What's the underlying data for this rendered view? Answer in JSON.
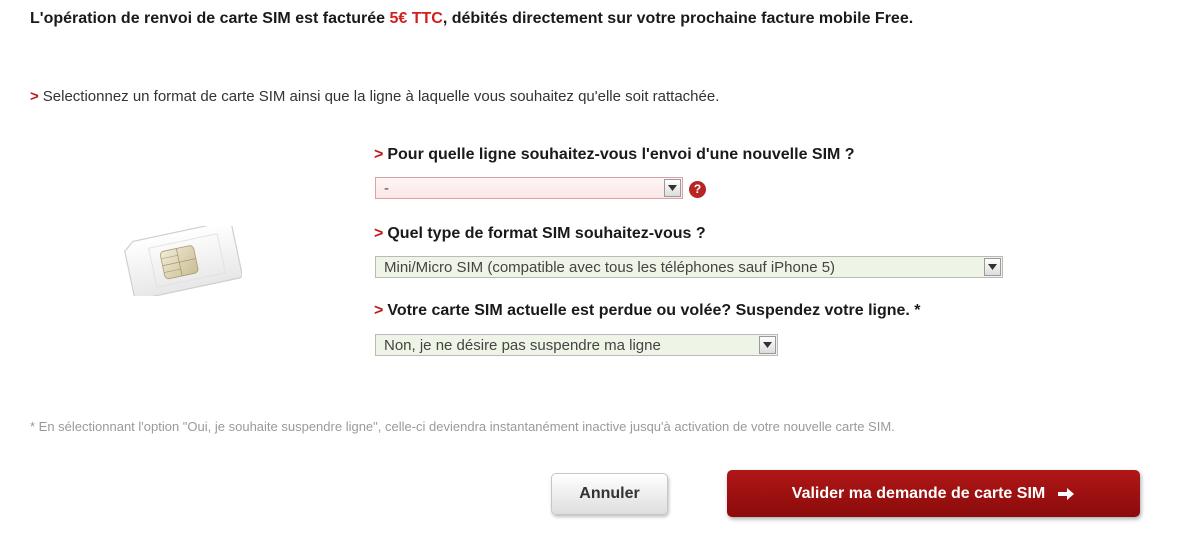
{
  "notice": {
    "prefix": "L'opération de renvoi de carte SIM est facturée ",
    "price": "5€ TTC",
    "suffix": ", débités directement sur votre prochaine facture mobile Free."
  },
  "instruction": {
    "marker": ">",
    "text": "Selectionnez un format de carte SIM ainsi que la ligne à laquelle vous souhaitez qu'elle soit rattachée."
  },
  "questions": [
    {
      "marker": ">",
      "label": "Pour quelle ligne souhaitez-vous l'envoi d'une nouvelle SIM ?",
      "selected": "-"
    },
    {
      "marker": ">",
      "label": "Quel type de format SIM souhaitez-vous ?",
      "selected": "Mini/Micro SIM (compatible avec tous les téléphones sauf iPhone 5)"
    },
    {
      "marker": ">",
      "label": "Votre carte SIM actuelle est perdue ou volée? Suspendez votre ligne. *",
      "selected": "Non, je ne désire pas suspendre ma ligne"
    }
  ],
  "help_icon": {
    "icon": "question-icon",
    "glyph": "?"
  },
  "footnote": "* En sélectionnant l'option \"Oui, je souhaite suspendre ligne\", celle-ci deviendra instantanément inactive jusqu'à activation de votre nouvelle carte SIM.",
  "buttons": {
    "cancel_label": "Annuler",
    "submit_label": "Valider ma demande de carte SIM",
    "submit_icon": "arrow-right-icon"
  },
  "colors": {
    "accent_red": "#c0161b",
    "submit_bg": "#a01212",
    "select_green_bg": "#eef4e6"
  }
}
